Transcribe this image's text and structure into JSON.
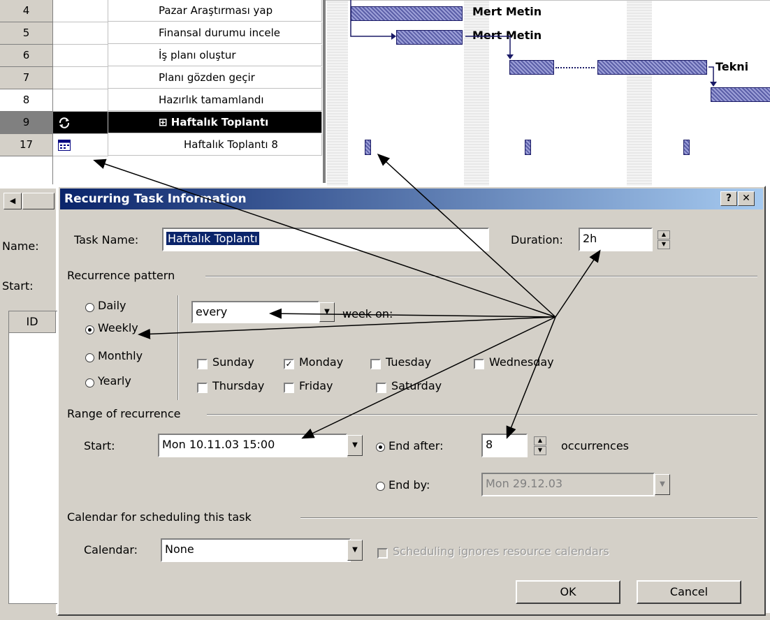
{
  "rows": [
    {
      "id": "4",
      "name": "Pazar Araştırması yap"
    },
    {
      "id": "5",
      "name": "Finansal durumu incele"
    },
    {
      "id": "6",
      "name": "İş planı oluştur"
    },
    {
      "id": "7",
      "name": "Planı gözden geçir"
    },
    {
      "id": "8",
      "name": "Hazırlık tamamlandı"
    },
    {
      "id": "9",
      "name": "⊞ Haftalık Toplantı"
    },
    {
      "id": "17",
      "name": "Haftalık Toplantı 8"
    }
  ],
  "gantt": {
    "resources": [
      "Mert Metin",
      "Mert Metin",
      "Tekni"
    ]
  },
  "sidepanel": {
    "name_label": "Name:",
    "start_label": "Start:",
    "id_header": "ID"
  },
  "dialog": {
    "title": "Recurring Task Information",
    "help_btn": "?",
    "close_btn": "✕",
    "task_name_label": "Task Name:",
    "task_name_value": "Haftalık Toplantı",
    "duration_label": "Duration:",
    "duration_value": "2h",
    "recurrence_group": "Recurrence pattern",
    "pattern_options": [
      "Daily",
      "Weekly",
      "Monthly",
      "Yearly"
    ],
    "pattern_selected": "Weekly",
    "every_value": "every",
    "week_on_label": "week on:",
    "days": [
      "Sunday",
      "Monday",
      "Tuesday",
      "Wednesday",
      "Thursday",
      "Friday",
      "Saturday"
    ],
    "day_checked": "Monday",
    "range_group": "Range of recurrence",
    "start_label": "Start:",
    "start_value": "Mon 10.11.03 15:00",
    "end_after_label": "End after:",
    "end_after_value": "8",
    "occurrences_label": "occurrences",
    "end_by_label": "End by:",
    "end_by_value": "Mon 29.12.03",
    "calendar_group": "Calendar for scheduling this task",
    "calendar_label": "Calendar:",
    "calendar_value": "None",
    "ignore_label": "Scheduling ignores resource calendars",
    "ok_label": "OK",
    "cancel_label": "Cancel"
  }
}
